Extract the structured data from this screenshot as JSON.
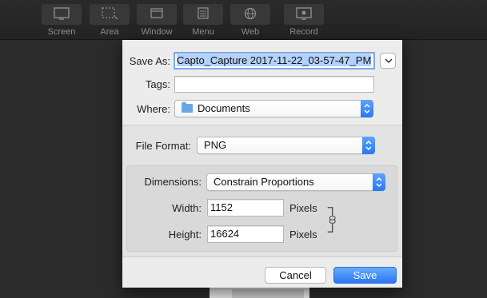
{
  "toolbar": {
    "items": [
      {
        "label": "Screen",
        "icon": "screen-icon"
      },
      {
        "label": "Area",
        "icon": "area-icon"
      },
      {
        "label": "Window",
        "icon": "window-icon"
      },
      {
        "label": "Menu",
        "icon": "menu-icon"
      },
      {
        "label": "Web",
        "icon": "web-icon"
      },
      {
        "label": "Record",
        "icon": "record-icon"
      }
    ]
  },
  "dialog": {
    "save_as_label": "Save As:",
    "save_as_value": "Capto_Capture 2017-11-22_03-57-47_PM",
    "tags_label": "Tags:",
    "tags_value": "",
    "where_label": "Where:",
    "where_value": "Documents",
    "file_format_label": "File Format:",
    "file_format_value": "PNG",
    "dimensions_label": "Dimensions:",
    "dimensions_value": "Constrain Proportions",
    "width_label": "Width:",
    "width_value": "1152",
    "width_unit": "Pixels",
    "height_label": "Height:",
    "height_value": "16624",
    "height_unit": "Pixels",
    "cancel_label": "Cancel",
    "save_label": "Save"
  },
  "colors": {
    "accent": "#2a7af3",
    "selection": "#b3d2fb",
    "toolbar_bg": "#252525"
  }
}
